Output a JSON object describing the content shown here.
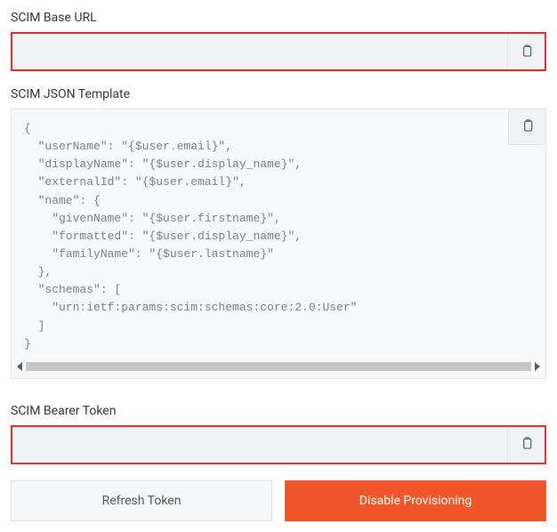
{
  "scimBaseUrl": {
    "label": "SCIM Base URL",
    "value": ""
  },
  "scimJsonTemplate": {
    "label": "SCIM JSON Template",
    "code": "{\n  \"userName\": \"{$user.email}\",\n  \"displayName\": \"{$user.display_name}\",\n  \"externalId\": \"{$user.email}\",\n  \"name\": {\n    \"givenName\": \"{$user.firstname}\",\n    \"formatted\": \"{$user.display_name}\",\n    \"familyName\": \"{$user.lastname}\"\n  },\n  \"schemas\": [\n    \"urn:ietf:params:scim:schemas:core:2.0:User\"\n  ]\n}"
  },
  "scimBearerToken": {
    "label": "SCIM Bearer Token",
    "value": ""
  },
  "buttons": {
    "refresh": "Refresh Token",
    "disable": "Disable Provisioning"
  }
}
